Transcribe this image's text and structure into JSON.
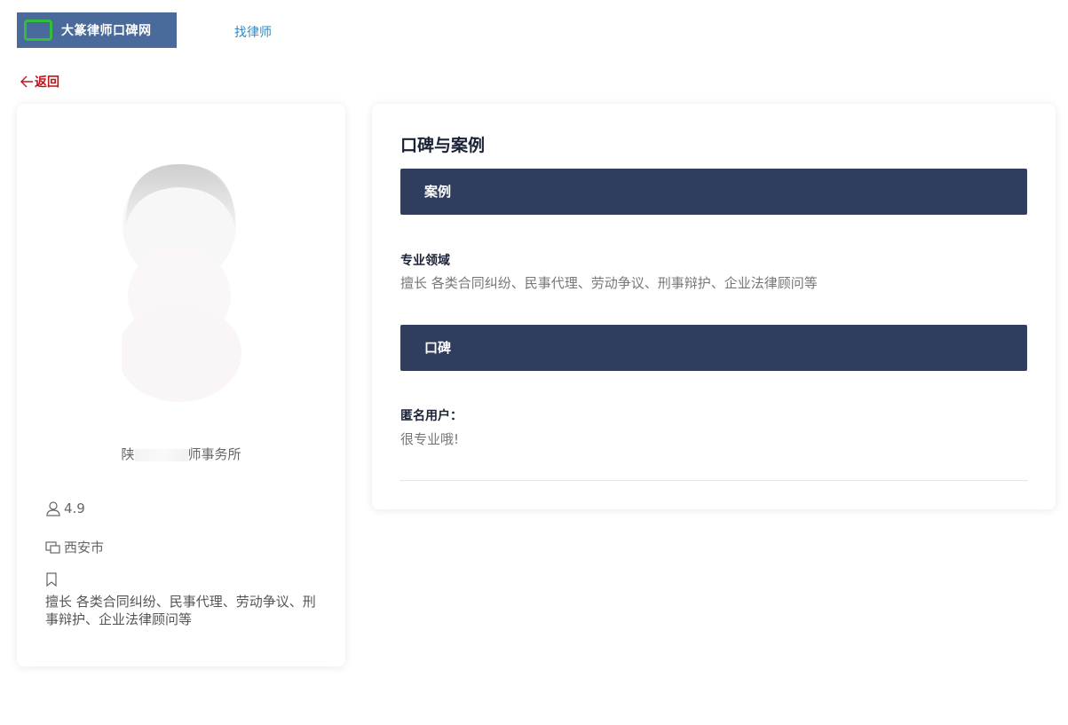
{
  "header": {
    "logo_text": "大篆律师口碑网",
    "nav_link": "找律师"
  },
  "back_label": "返回",
  "profile": {
    "firm_prefix": "陕",
    "firm_suffix": "师事务所",
    "rating": "4.9",
    "city": "西安市",
    "specialty": "擅长 各类合同纠纷、民事代理、劳动争议、刑事辩护、企业法律顾问等"
  },
  "main": {
    "title": "口碑与案例",
    "case_bar": "案例",
    "field_label": "专业领域",
    "field_text": "擅长 各类合同纠纷、民事代理、劳动争议、刑事辩护、企业法律顾问等",
    "review_bar": "口碑",
    "reviewer": "匿名用户：",
    "review_text": "很专业哦!"
  },
  "colors": {
    "logo_bg": "#4a6a9c",
    "logo_mark": "#2fbf3a",
    "nav_link": "#2a8ac8",
    "back": "#c0141b",
    "bar_bg": "#2f3d5e"
  },
  "icons": {
    "back": "arrow-left-icon",
    "rating": "user-icon",
    "city": "location-icon",
    "tag": "bookmark-icon"
  }
}
